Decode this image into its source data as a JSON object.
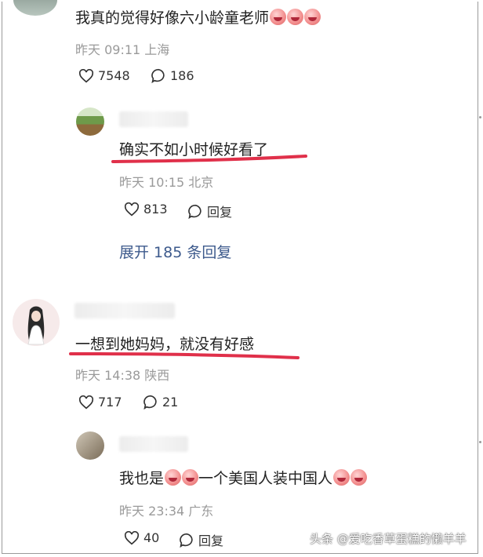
{
  "comments": {
    "top": {
      "text": "我真的觉得好像六小龄童老师",
      "meta": "昨天 09:11 上海",
      "likes": "7548",
      "replies": "186"
    },
    "reply1": {
      "text": "确实不如小时候好看了",
      "meta": "昨天 10:15 北京",
      "likes": "813",
      "reply_label": "回复"
    },
    "expand": {
      "label": "展开 185 条回复"
    },
    "second": {
      "text": "一想到她妈妈，就没有好感",
      "meta": "昨天 14:38 陕西",
      "likes": "717",
      "replies": "21"
    },
    "reply2": {
      "text_a": "我也是",
      "text_b": "一个美国人装中国人",
      "meta": "昨天 23:34 广东",
      "likes": "40",
      "reply_label": "回复"
    }
  },
  "watermark": "头条 @爱吃香草蛋糕的懒羊羊",
  "colors": {
    "underline": "#e0304a",
    "link": "#3d5a8c",
    "meta": "#9a9a9a"
  }
}
